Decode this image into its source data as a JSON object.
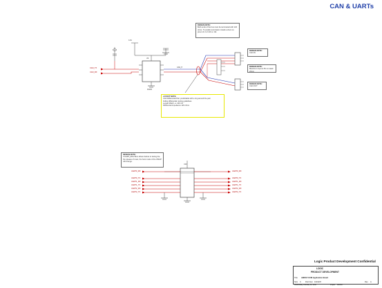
{
  "page_title": "CAN & UARTs",
  "notes": {
    "can_termination": {
      "head": "DESIGN NOTE:",
      "lines": [
        "Both ends of the bus must be terminated with 120",
        "ohms. To enable termination install a shunt on",
        "pins 2 & 3 of J13 or J14."
      ]
    },
    "can_layout": {
      "head": "LAYOUT NOTE:",
      "lines": [
        "CAN Differential Pair, predictable with a ring around the pair.",
        "Follow differential routing guidelines.",
        "Length Match +/- 100 mil",
        "Differential impedance 120 ohms"
      ]
    },
    "can_in": {
      "head": "DESIGN NOTE:",
      "lines": [
        "CAN IN"
      ]
    },
    "max_current": {
      "head": "DESIGN NOTE:",
      "lines": [
        "Maximum input is 5V on rated 20mA"
      ]
    },
    "can_out": {
      "head": "DESIGN NOTE:",
      "lines": [
        "CAN OUT"
      ]
    },
    "uart_console": {
      "head": "DESIGN NOTE:",
      "lines": [
        "If UART_ROUTE is driven before or during the",
        "the release of reset, the boot mode of the OMAP",
        "will change."
      ]
    }
  },
  "nets_left_can": [
    "CAN_TX",
    "CAN_RX"
  ],
  "nets_left_uart": [
    "UART0_RX",
    "UART0_TX",
    "UART1_RX",
    "UART1_TX",
    "UART2_RX",
    "UART2_TX"
  ],
  "nets_right_uart": [
    "UART0_RX",
    "UART0_TX",
    "UART1_RX",
    "UART1_TX",
    "UART2_RX",
    "UART2_TX"
  ],
  "component_labels": {
    "can_transceiver": "U9",
    "uart_buffer": "U10",
    "gnd": "DGND",
    "vcc": "3.3V",
    "can_bus": "CAN_H"
  },
  "title_block": {
    "confidential": "Logic Product Development Confidential",
    "company": "LOGIC",
    "division": "PRODUCT DEVELOPMENT",
    "title_label": "Title",
    "title_value": "AM3517 EVM Application Board",
    "size_label": "Size",
    "size_value": "C",
    "part_label": "Part Num",
    "part_value": "1019197",
    "rev_label": "Rev",
    "rev_value": "A",
    "date_value": "Wednesday, February 24, 2010",
    "project_label": "Project",
    "project_value": "AM3517"
  },
  "colors": {
    "title_blue": "#1f3fa8",
    "wire_red": "#c80000",
    "wire_blue": "#1a2fb0",
    "note_yellow": "#e8e800"
  }
}
